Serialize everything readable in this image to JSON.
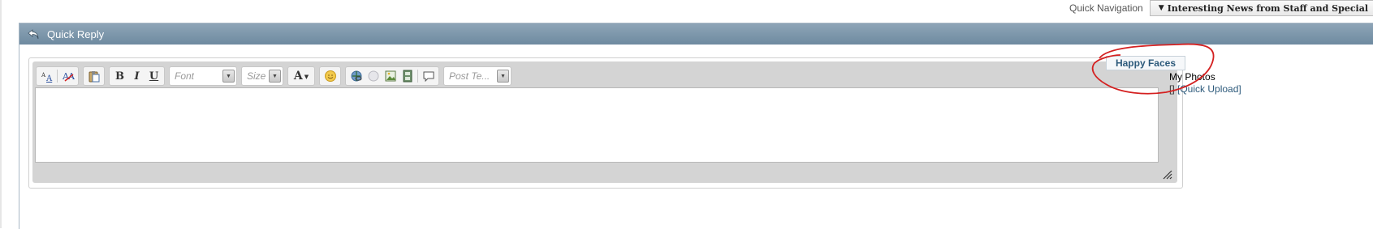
{
  "quick_nav": {
    "label": "Quick Navigation",
    "selected": "Interesting News from Staff and Special"
  },
  "panel": {
    "title": "Quick Reply"
  },
  "toolbar": {
    "font_placeholder": "Font",
    "size_placeholder": "Size",
    "post_template_placeholder": "Post Te...",
    "icons": [
      "remove-format-icon",
      "remove-text-format-icon",
      "paste-icon",
      "bold-icon",
      "italic-icon",
      "underline-icon",
      "text-color-icon",
      "smiley-icon",
      "link-icon",
      "unlink-icon",
      "image-icon",
      "video-icon",
      "quote-icon"
    ]
  },
  "sidebar": {
    "tab_label": "Happy Faces",
    "photos_title": "My Photos",
    "upload_prefix": "[]",
    "upload_link": "[Quick Upload]"
  },
  "colors": {
    "header": "#7e97ab",
    "link": "#2d5a7b",
    "annotation": "#d42020"
  }
}
